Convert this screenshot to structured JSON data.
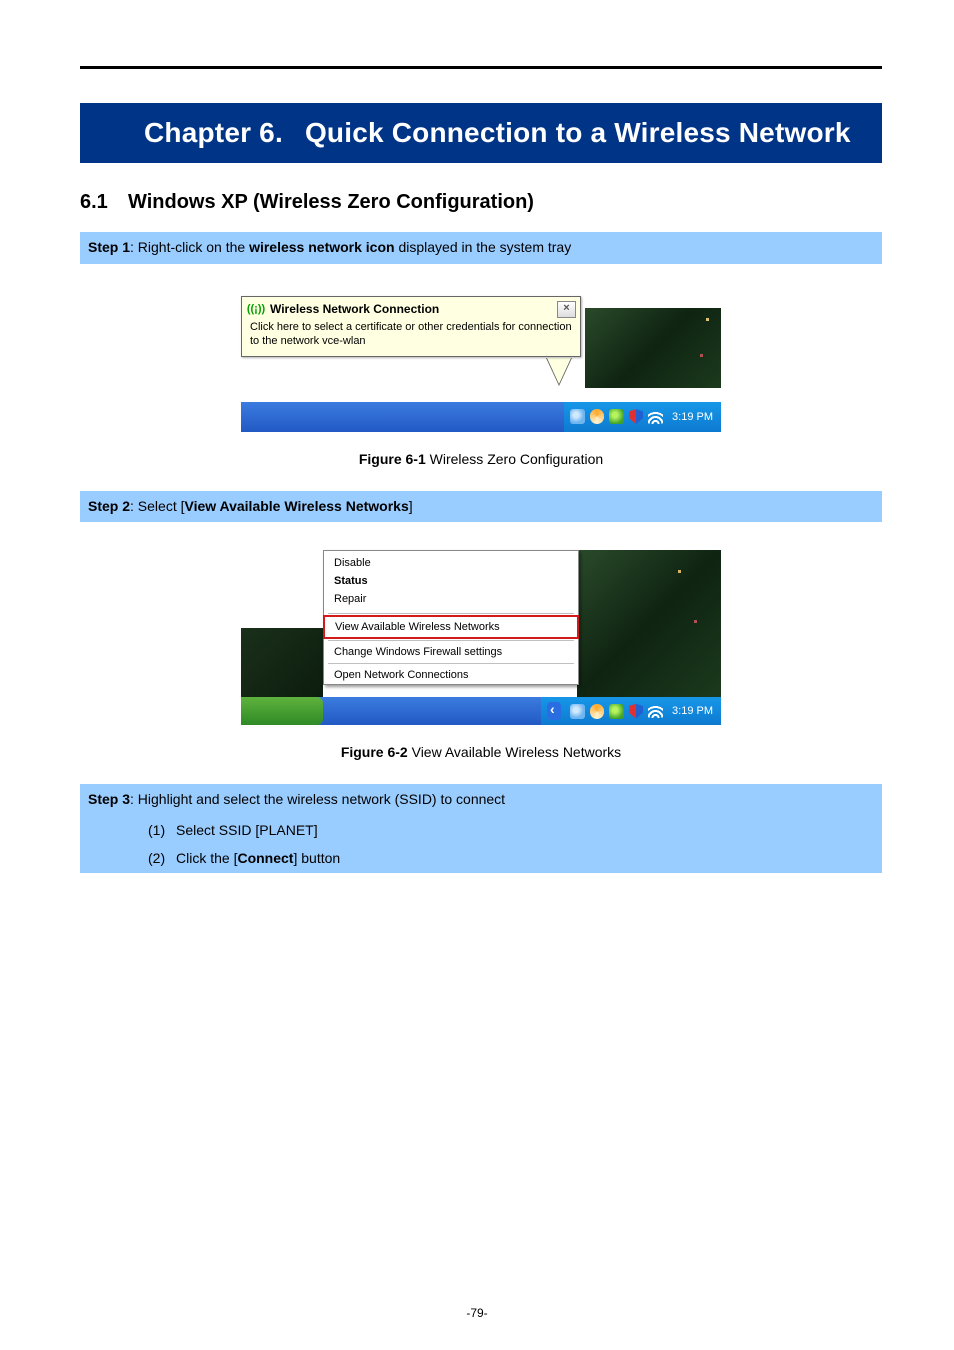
{
  "chapter_banner": {
    "prefix": "Chapter 6.",
    "title": "Quick Connection to a Wireless Network"
  },
  "section": {
    "number": "6.1",
    "title": "Windows XP (Wireless Zero Configuration)"
  },
  "step1": {
    "label": "Step 1",
    "before": ": Right-click on the ",
    "bold": "wireless network icon",
    "after": " displayed in the system tray"
  },
  "fig1": {
    "balloon_title": "Wireless Network Connection",
    "balloon_body": "Click here to select a certificate or other credentials for connection to the network vce-wlan",
    "close_glyph": "×",
    "icon_glyph": "((¡))",
    "tray_time": "3:19 PM",
    "caption_bold": "Figure 6-1",
    "caption_rest": " Wireless Zero Configuration"
  },
  "step2": {
    "label": "Step 2",
    "before": ": Select [",
    "bold": "View Available Wireless Networks",
    "after": "]"
  },
  "fig2": {
    "menu": {
      "disable": "Disable",
      "status": "Status",
      "repair": "Repair",
      "view": "View Available Wireless Networks",
      "firewall": "Change Windows Firewall settings",
      "open": "Open Network Connections"
    },
    "tray_time": "3:19 PM",
    "caption_bold": "Figure 6-2",
    "caption_rest": " View Available Wireless Networks"
  },
  "step3": {
    "label": "Step 3",
    "rest": ": Highlight and select the wireless network (SSID) to connect",
    "item1_num": "(1)",
    "item1_text": "Select SSID [PLANET]",
    "item2_num": "(2)",
    "item2_before": "Click the [",
    "item2_bold": "Connect",
    "item2_after": "] button"
  },
  "page_number": "-79-"
}
